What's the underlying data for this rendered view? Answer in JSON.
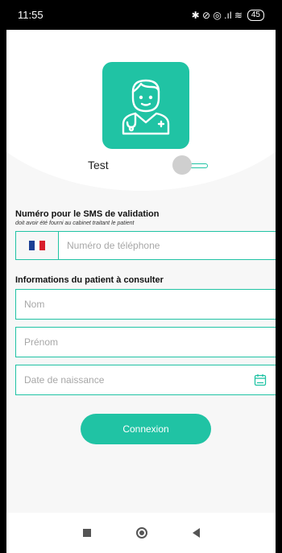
{
  "status_bar": {
    "time": "11:55",
    "icons_text": "✱ ⊘ ◎ .ıl ≋",
    "battery": "45"
  },
  "toggle": {
    "label": "Test",
    "on": false
  },
  "sms_section": {
    "title": "Numéro pour le SMS de validation",
    "hint": "doit avoir été fourni au cabinet traitant le patient",
    "phone_placeholder": "Numéro de téléphone",
    "country_flag": "france-flag-icon"
  },
  "patient_section": {
    "title": "Informations du patient à consulter",
    "nom_placeholder": "Nom",
    "prenom_placeholder": "Prénom",
    "dob_placeholder": "Date de naissance"
  },
  "connect_label": "Connexion",
  "colors": {
    "accent": "#20c3a4",
    "flag_blue": "#1c3f95",
    "flag_red": "#d81e2c"
  },
  "icons": [
    "doctor-icon",
    "calendar-icon",
    "recent-apps-icon",
    "home-icon",
    "back-icon"
  ]
}
